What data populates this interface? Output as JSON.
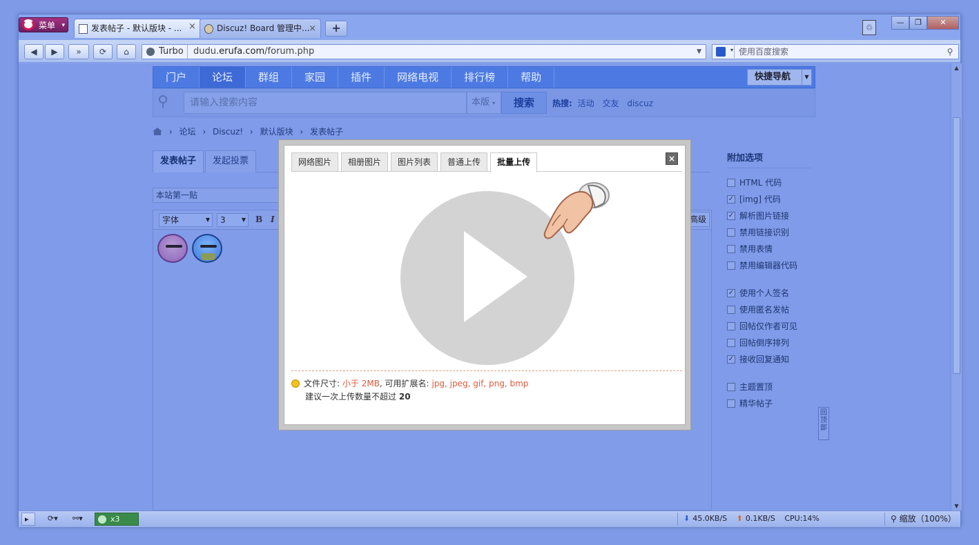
{
  "browser": {
    "menu_label": "菜单",
    "tabs": [
      {
        "title": "发表帖子 - 默认版块 - ..."
      },
      {
        "title": "Discuz! Board 管理中..."
      }
    ],
    "new_tab_label": "+",
    "turbo_label": "Turbo",
    "url_prefix": "dudu.",
    "url_domain": "erufa.com",
    "url_path": "/forum.php",
    "search_placeholder": "使用百度搜索",
    "status": {
      "x3_label": "x3",
      "download_speed": "45.0KB/S",
      "upload_speed": "0.1KB/S",
      "cpu": "CPU:14%",
      "zoom": "缩放（100%）"
    }
  },
  "site": {
    "nav": [
      "门户",
      "论坛",
      "群组",
      "家园",
      "插件",
      "网络电视",
      "排行榜",
      "帮助"
    ],
    "quick_nav_label": "快捷导航",
    "search": {
      "placeholder": "请输入搜索内容",
      "scope": "本版",
      "button": "搜索",
      "hot_label": "热搜:",
      "hot_terms": [
        "活动",
        "交友",
        "discuz"
      ]
    },
    "breadcrumb": [
      "论坛",
      "Discuz!",
      "默认版块",
      "发表帖子"
    ],
    "post_tabs": [
      "发表帖子",
      "发起投票"
    ],
    "subject_value": "本站第一贴",
    "editor": {
      "font_select": "字体",
      "size_select": "3",
      "bold": "B",
      "italic": "I",
      "advanced": "高级"
    },
    "options": {
      "heading": "附加选项",
      "group1": [
        {
          "label": "HTML 代码",
          "checked": false
        },
        {
          "label": "[img] 代码",
          "checked": true
        },
        {
          "label": "解析图片链接",
          "checked": true
        },
        {
          "label": "禁用链接识别",
          "checked": false
        },
        {
          "label": "禁用表情",
          "checked": false
        },
        {
          "label": "禁用编辑器代码",
          "checked": false
        }
      ],
      "group2": [
        {
          "label": "使用个人签名",
          "checked": true
        },
        {
          "label": "使用匿名发帖",
          "checked": false
        },
        {
          "label": "回帖仅作者可见",
          "checked": false
        },
        {
          "label": "回帖倒序排列",
          "checked": false
        },
        {
          "label": "接收回复通知",
          "checked": true
        }
      ],
      "group3": [
        {
          "label": "主题置顶",
          "checked": false
        },
        {
          "label": "精华帖子",
          "checked": false
        }
      ]
    },
    "back_to_top": "回顶部"
  },
  "dialog": {
    "tabs": [
      "网络图片",
      "相册图片",
      "图片列表",
      "普通上传",
      "批量上传"
    ],
    "active_tab": "批量上传",
    "close_label": "×",
    "info": {
      "size_label": "文件尺寸:",
      "size_value": "小于 2MB",
      "ext_label": ", 可用扩展名:",
      "ext_value": "jpg, jpeg, gif, png, bmp",
      "limit_label": "建议一次上传数量不超过",
      "limit_value": "20"
    }
  }
}
